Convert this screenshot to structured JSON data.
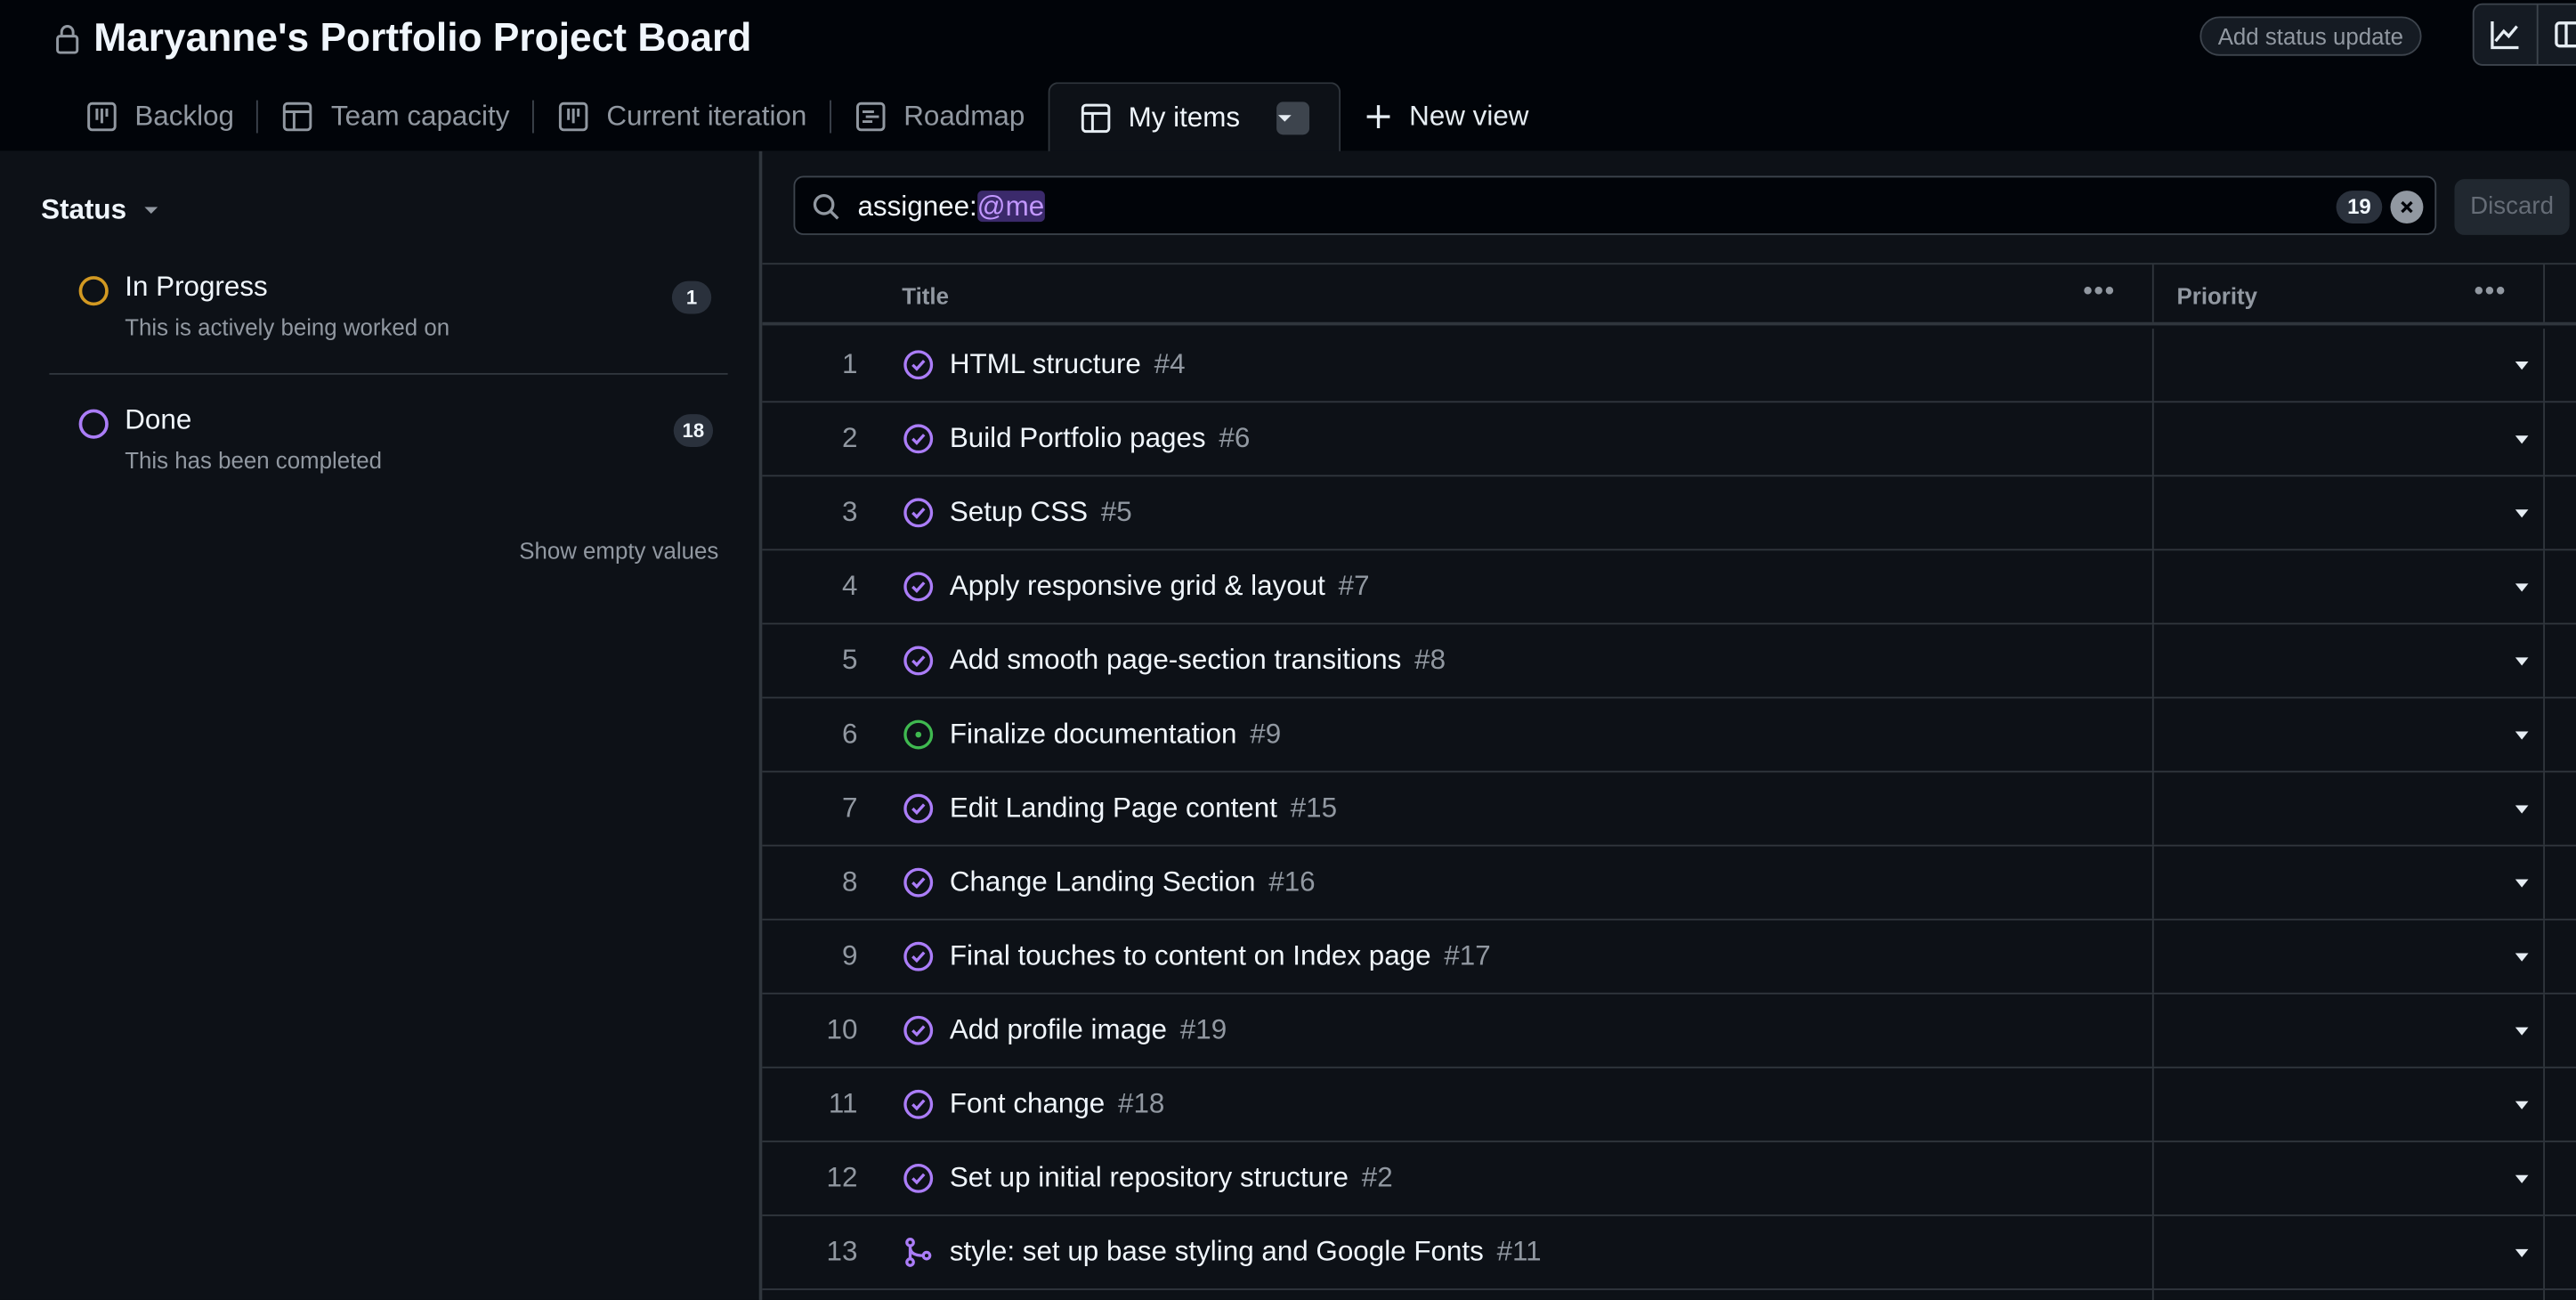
{
  "header": {
    "title": "Maryanne's Portfolio Project Board",
    "status_update_label": "Add status update"
  },
  "tabs": [
    {
      "label": "Backlog",
      "icon": "board-icon"
    },
    {
      "label": "Team capacity",
      "icon": "table-icon"
    },
    {
      "label": "Current iteration",
      "icon": "board-icon"
    },
    {
      "label": "Roadmap",
      "icon": "roadmap-icon"
    },
    {
      "label": "My items",
      "icon": "table-icon",
      "active": true
    },
    {
      "label": "New view",
      "icon": "plus-icon"
    }
  ],
  "sidebar": {
    "group_label": "Status",
    "statuses": [
      {
        "name": "In Progress",
        "description": "This is actively being worked on",
        "count": "1",
        "color": "#d29922"
      },
      {
        "name": "Done",
        "description": "This has been completed",
        "count": "18",
        "color": "#ab7df8"
      }
    ],
    "show_empty": "Show empty values"
  },
  "filter": {
    "prefix": "assignee:",
    "value": "@me",
    "count": "19",
    "discard_label": "Discard"
  },
  "columns": {
    "title": "Title",
    "priority": "Priority"
  },
  "rows": [
    {
      "n": "1",
      "title": "HTML structure",
      "ref": "#4",
      "state": "done"
    },
    {
      "n": "2",
      "title": "Build Portfolio pages",
      "ref": "#6",
      "state": "done"
    },
    {
      "n": "3",
      "title": "Setup CSS",
      "ref": "#5",
      "state": "done"
    },
    {
      "n": "4",
      "title": "Apply responsive grid & layout",
      "ref": "#7",
      "state": "done"
    },
    {
      "n": "5",
      "title": "Add smooth page-section transitions",
      "ref": "#8",
      "state": "done"
    },
    {
      "n": "6",
      "title": "Finalize documentation",
      "ref": "#9",
      "state": "open"
    },
    {
      "n": "7",
      "title": "Edit Landing Page content",
      "ref": "#15",
      "state": "done"
    },
    {
      "n": "8",
      "title": "Change Landing Section",
      "ref": "#16",
      "state": "done"
    },
    {
      "n": "9",
      "title": "Final touches to content on Index page",
      "ref": "#17",
      "state": "done"
    },
    {
      "n": "10",
      "title": "Add profile image",
      "ref": "#19",
      "state": "done"
    },
    {
      "n": "11",
      "title": "Font change",
      "ref": "#18",
      "state": "done"
    },
    {
      "n": "12",
      "title": "Set up initial repository structure",
      "ref": "#2",
      "state": "done"
    },
    {
      "n": "13",
      "title": "style: set up base styling and Google Fonts",
      "ref": "#11",
      "state": "merged"
    }
  ],
  "colors": {
    "done": "#ab7df8",
    "open": "#3fb950",
    "merged": "#ab7df8",
    "in_progress": "#d29922"
  }
}
